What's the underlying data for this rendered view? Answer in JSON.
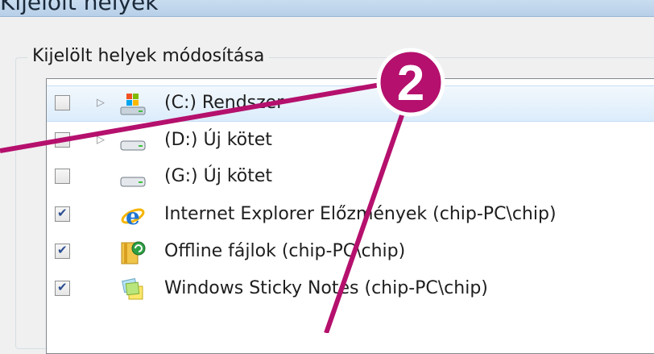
{
  "window": {
    "title": "Kijelölt helyek"
  },
  "group": {
    "legend": "Kijelölt helyek módosítása"
  },
  "locations": [
    {
      "label": "(C:) Rendszer",
      "checked": false,
      "expandable": true,
      "icon": "windows-drive-icon",
      "selected": true
    },
    {
      "label": "(D:) Új kötet",
      "checked": false,
      "expandable": true,
      "icon": "drive-icon",
      "selected": false
    },
    {
      "label": "(G:) Új kötet",
      "checked": false,
      "expandable": false,
      "icon": "drive-icon",
      "selected": false
    },
    {
      "label": "Internet Explorer Előzmények (chip-PC\\chip)",
      "checked": true,
      "expandable": false,
      "icon": "internet-explorer-icon",
      "selected": false
    },
    {
      "label": "Offline fájlok (chip-PC\\chip)",
      "checked": true,
      "expandable": false,
      "icon": "offline-files-icon",
      "selected": false
    },
    {
      "label": "Windows Sticky Notes (chip-PC\\chip)",
      "checked": true,
      "expandable": false,
      "icon": "sticky-notes-icon",
      "selected": false
    }
  ],
  "callout": {
    "number": "2",
    "color": "#b5106d"
  }
}
